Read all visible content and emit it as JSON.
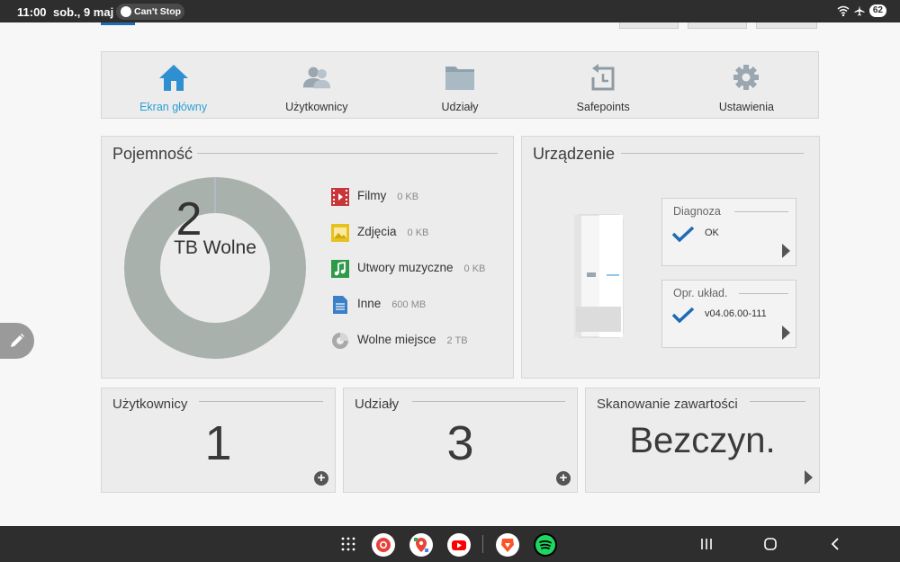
{
  "status_bar": {
    "time": "11:00",
    "date": "sob., 9 maj",
    "media_chip": "Can't Stop",
    "battery": "62"
  },
  "nav": {
    "items": [
      {
        "label": "Ekran główny",
        "icon": "home-icon",
        "active": true
      },
      {
        "label": "Użytkownicy",
        "icon": "users-icon",
        "active": false
      },
      {
        "label": "Udziały",
        "icon": "folder-icon",
        "active": false
      },
      {
        "label": "Safepoints",
        "icon": "safepoint-icon",
        "active": false
      },
      {
        "label": "Ustawienia",
        "icon": "gear-icon",
        "active": false
      }
    ]
  },
  "capacity": {
    "title": "Pojemność",
    "free_value": "2",
    "free_label": "TB Wolne",
    "legend": [
      {
        "name": "Filmy",
        "value": "0 KB",
        "icon": "film-icon",
        "color": "#c8353a"
      },
      {
        "name": "Zdjęcia",
        "value": "0 KB",
        "icon": "photo-icon",
        "color": "#e6c21f"
      },
      {
        "name": "Utwory muzyczne",
        "value": "0 KB",
        "icon": "music-icon",
        "color": "#2e9a4a"
      },
      {
        "name": "Inne",
        "value": "600 MB",
        "icon": "document-icon",
        "color": "#3a7fc7"
      },
      {
        "name": "Wolne miejsce",
        "value": "2 TB",
        "icon": "pie-icon",
        "color": "#a9a9a9"
      }
    ],
    "donut_color": "#a9b1ad"
  },
  "device": {
    "title": "Urządzenie",
    "diagnosis": {
      "title": "Diagnoza",
      "value": "OK"
    },
    "firmware": {
      "title": "Opr. układ.",
      "value": "v04.06.00-111"
    }
  },
  "users_card": {
    "title": "Użytkownicy",
    "value": "1"
  },
  "shares_card": {
    "title": "Udziały",
    "value": "3"
  },
  "scan_card": {
    "title": "Skanowanie zawartości",
    "value": "Bezczyn."
  },
  "colors": {
    "accent": "#2aa0d4",
    "check": "#1f6bb3"
  }
}
